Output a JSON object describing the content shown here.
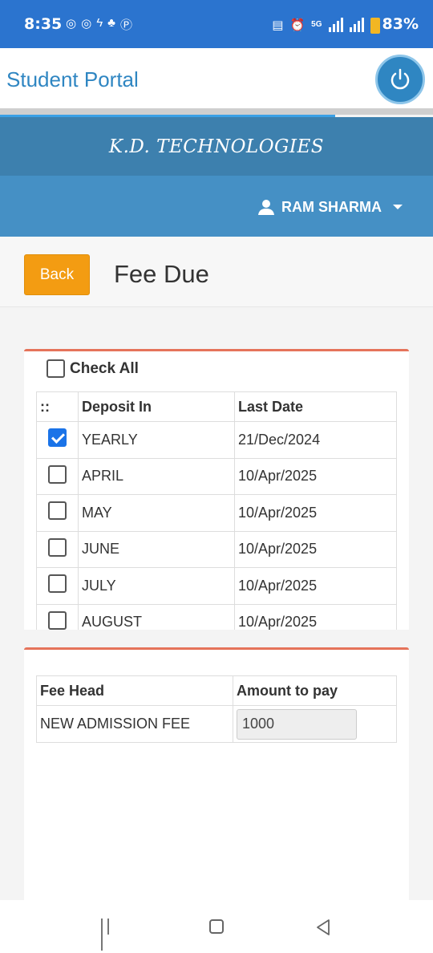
{
  "status": {
    "time": "8:35",
    "battery": "83%",
    "network": "5G"
  },
  "app": {
    "title": "Student Portal"
  },
  "company": {
    "name": "K.D. TECHNOLOGIES"
  },
  "user": {
    "name": "RAM SHARMA"
  },
  "page": {
    "back_label": "Back",
    "title": "Fee Due"
  },
  "deposit": {
    "check_all_label": "Check All",
    "headers": {
      "select": "::",
      "deposit_in": "Deposit In",
      "last_date": "Last Date"
    },
    "rows": [
      {
        "deposit_in": "YEARLY",
        "last_date": "21/Dec/2024",
        "checked": true
      },
      {
        "deposit_in": "APRIL",
        "last_date": "10/Apr/2025",
        "checked": false
      },
      {
        "deposit_in": "MAY",
        "last_date": "10/Apr/2025",
        "checked": false
      },
      {
        "deposit_in": "JUNE",
        "last_date": "10/Apr/2025",
        "checked": false
      },
      {
        "deposit_in": "JULY",
        "last_date": "10/Apr/2025",
        "checked": false
      },
      {
        "deposit_in": "AUGUST",
        "last_date": "10/Apr/2025",
        "checked": false
      }
    ]
  },
  "fees": {
    "headers": {
      "fee_head": "Fee Head",
      "amount": "Amount to pay"
    },
    "rows": [
      {
        "fee_head": "NEW ADMISSION FEE",
        "amount": "1000"
      }
    ]
  },
  "colors": {
    "statusbar": "#2b74cf",
    "header": "#3d80ae",
    "userbar": "#4590c5",
    "accent": "#f39c12",
    "card_border": "#e5735a"
  }
}
